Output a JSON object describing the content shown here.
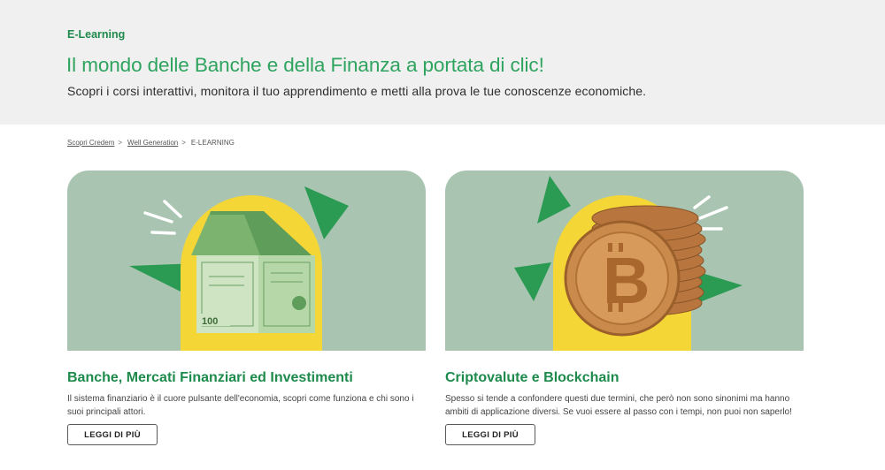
{
  "hero": {
    "eyebrow": "E-Learning",
    "title": "Il mondo delle Banche e della Finanza a portata di clic!",
    "subtitle": "Scopri i corsi interattivi, monitora il tuo apprendimento e metti alla prova le tue conoscenze economiche."
  },
  "breadcrumb": {
    "items": [
      {
        "label": "Scopri Credem"
      },
      {
        "label": "Well Generation"
      },
      {
        "label": "E-LEARNING"
      }
    ],
    "separator": ">"
  },
  "cards": [
    {
      "title": "Banche, Mercati Finanziari ed Investimenti",
      "text": "Il sistema finanziario è il cuore pulsante dell'economia, scopri come funziona e chi sono i suoi principali attori.",
      "button": "LEGGI DI PIÙ",
      "image_icon": "banknote-house-icon"
    },
    {
      "title": "Criptovalute e Blockchain",
      "text": "Spesso si tende a confondere questi due termini, che però non sono sinonimi ma hanno ambiti di applicazione diversi. Se vuoi essere al passo con i tempi, non puoi non saperlo!",
      "button": "LEGGI DI PIÙ",
      "image_icon": "bitcoin-coin-stack-icon"
    }
  ],
  "colors": {
    "brand_green": "#1e8a4c",
    "title_green": "#2ea45f",
    "card_bg": "#a9c5b2",
    "accent_yellow": "#f5d637",
    "hero_bg": "#f0f0f0"
  }
}
